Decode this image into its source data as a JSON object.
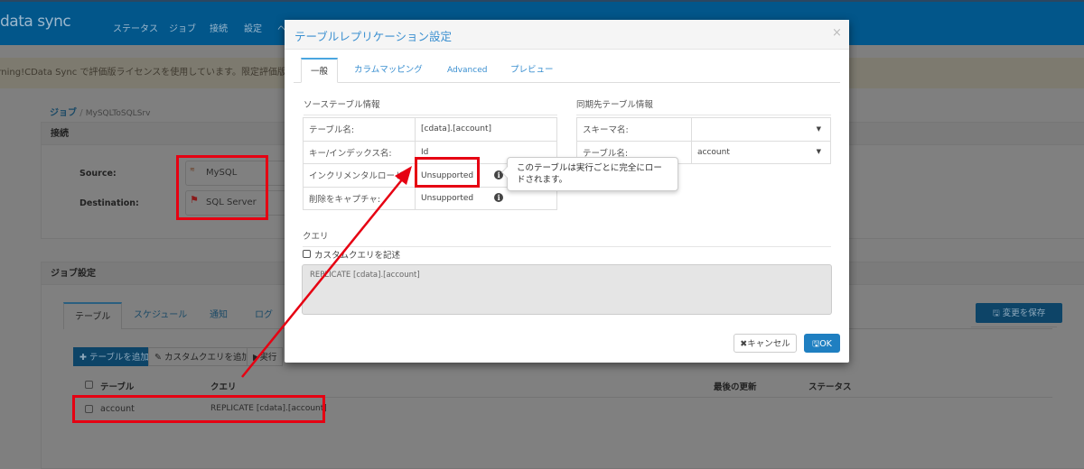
{
  "header": {
    "logo": "data sync",
    "nav": [
      "ステータス",
      "ジョブ",
      "接続",
      "設定",
      "ヘルプ"
    ]
  },
  "warning": "Warning!CData Sync で評価版ライセンスを使用しています。限定評価版ライセンス",
  "breadcrumb": {
    "root": "ジョブ",
    "sep": "/",
    "current": "MySQLToSQLSrv"
  },
  "connection": {
    "title": "接続",
    "source_label": "Source:",
    "source_value": "MySQL",
    "dest_label": "Destination:",
    "dest_value": "SQL Server"
  },
  "job_settings": {
    "title": "ジョブ設定",
    "tabs": [
      "テーブル",
      "スケジュール",
      "通知",
      "ログ"
    ],
    "add_table": "テーブルを追加",
    "add_custom_query": "カスタムクエリを追加",
    "run": "実行",
    "save": "変更を保存",
    "columns": [
      "テーブル",
      "クエリ",
      "最後の更新",
      "ステータス"
    ],
    "rows": [
      {
        "table": "account",
        "query": "REPLICATE [cdata].[account]"
      }
    ]
  },
  "modal": {
    "title": "テーブルレプリケーション設定",
    "close": "×",
    "tabs": [
      "一般",
      "カラムマッピング",
      "Advanced",
      "プレビュー"
    ],
    "source_section": "ソーステーブル情報",
    "source_rows": [
      {
        "label": "テーブル名:",
        "value": "[cdata].[account]"
      },
      {
        "label": "キー/インデックス名:",
        "value": "Id"
      },
      {
        "label": "インクリメンタルロード:",
        "value": "Unsupported"
      },
      {
        "label": "削除をキャプチャ:",
        "value": "Unsupported"
      }
    ],
    "dest_section": "同期先テーブル情報",
    "dest_rows": [
      {
        "label": "スキーマ名:",
        "value": ""
      },
      {
        "label": "テーブル名:",
        "value": "account"
      }
    ],
    "tooltip": "このテーブルは実行ごとに完全にロードされます。",
    "query_section": "クエリ",
    "custom_query_label": "カスタムクエリを記述",
    "query_text": "REPLICATE [cdata].[account]",
    "cancel": "キャンセル",
    "ok": "OK"
  },
  "colors": {
    "header": "#02568a",
    "accent": "#1f7fc1",
    "annotation": "#e60012"
  }
}
